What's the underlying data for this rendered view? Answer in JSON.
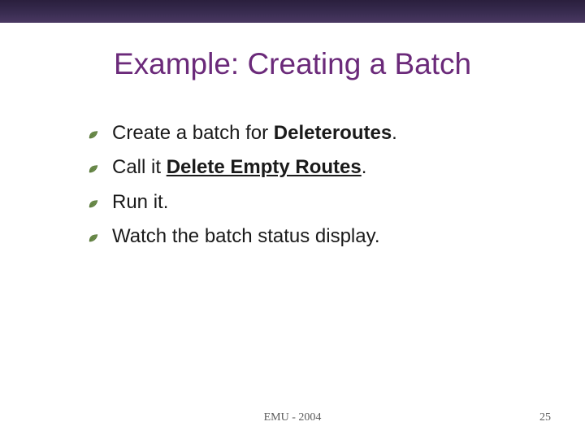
{
  "slide": {
    "title": "Example:  Creating a Batch",
    "bullets": [
      {
        "segments": [
          {
            "text": "Create a batch for ",
            "bold": false,
            "underline": false
          },
          {
            "text": "Deleteroutes",
            "bold": true,
            "underline": false
          },
          {
            "text": ".",
            "bold": false,
            "underline": false
          }
        ]
      },
      {
        "segments": [
          {
            "text": "Call it ",
            "bold": false,
            "underline": false
          },
          {
            "text": "Delete Empty Routes",
            "bold": true,
            "underline": true
          },
          {
            "text": ".",
            "bold": false,
            "underline": false
          }
        ]
      },
      {
        "segments": [
          {
            "text": "Run it.",
            "bold": false,
            "underline": false
          }
        ]
      },
      {
        "segments": [
          {
            "text": "Watch the batch status display.",
            "bold": false,
            "underline": false
          }
        ]
      }
    ],
    "footer_center": "EMU - 2004",
    "footer_right": "25"
  },
  "colors": {
    "title": "#6b2a7a",
    "bullet_icon": "#6a8a4a",
    "text": "#1a1a1a"
  }
}
